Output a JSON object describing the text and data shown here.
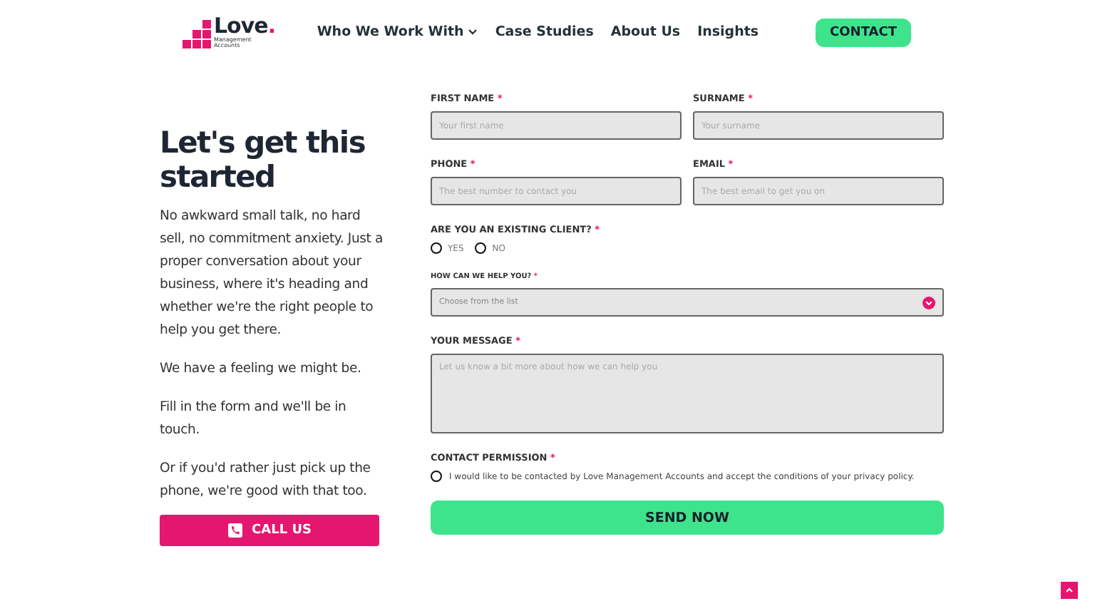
{
  "header": {
    "logo": {
      "wordmark": "Love",
      "dot": ".",
      "subtitle": "Management Accounts"
    },
    "nav": [
      {
        "label": "Who We Work With",
        "dropdown": true
      },
      {
        "label": "Case Studies",
        "dropdown": false
      },
      {
        "label": "About Us",
        "dropdown": false
      },
      {
        "label": "Insights",
        "dropdown": false
      }
    ],
    "cta": "CONTACT"
  },
  "intro": {
    "heading": "Let's get this started",
    "paragraphs": [
      "No awkward small talk, no hard sell, no commitment anxiety. Just a proper conversation about your business, where it's heading and whether we're the right people to help you get there.",
      "We have a feeling we might be.",
      "Fill in the form and we'll be in touch.",
      "Or if you'd rather just pick up the phone, we're good with that too."
    ],
    "call_button": "CALL US"
  },
  "form": {
    "rows": [
      [
        {
          "label": "FIRST NAME",
          "mark": "*",
          "placeholder": "Your first name"
        },
        {
          "label": "SURNAME",
          "mark": "*",
          "placeholder": "Your surname"
        }
      ],
      [
        {
          "label": "PHONE",
          "mark": "*",
          "placeholder": "The best number to contact you"
        },
        {
          "label": "EMAIL",
          "mark": "*",
          "placeholder": "The best email to get you on"
        }
      ]
    ],
    "client": {
      "label": "ARE YOU AN EXISTING CLIENT?",
      "mark": "*",
      "options": [
        {
          "label": "YES",
          "selected": false
        },
        {
          "label": "NO",
          "selected": false
        }
      ]
    },
    "help": {
      "label": "HOW CAN WE HELP YOU?",
      "mark": "*",
      "placeholder": "Choose from the list"
    },
    "message": {
      "label": "YOUR MESSAGE",
      "mark": "*",
      "placeholder": "Let us know a bit more about how we can help you"
    },
    "permission": {
      "label": "CONTACT PERMISSION",
      "mark": "*",
      "text": "I would like to be contacted by Love Management Accounts and accept the conditions of your privacy policy.",
      "checked": false
    },
    "submit": "SEND NOW"
  }
}
